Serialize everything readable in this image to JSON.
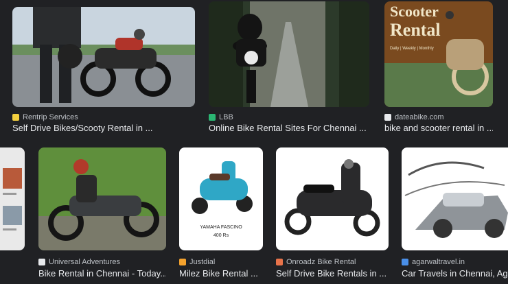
{
  "results": [
    {
      "source": "Rentrip Services",
      "title": "Self Drive Bikes/Scooty Rental in ...",
      "favicon_color": "#f4d03f"
    },
    {
      "source": "LBB",
      "title": "Online Bike Rental Sites For Chennai ...",
      "favicon_color": "#2bb673"
    },
    {
      "source": "dateabike.com",
      "title": "bike and scooter rental in ...",
      "favicon_color": "#e8eaed",
      "poster_text": "Scooter",
      "poster_title": "Rental",
      "poster_sub": "Daily | Weekly | Monthly"
    },
    {
      "source": "Universal Adventures",
      "title": "Bike Rental in Chennai - Today...",
      "favicon_color": "#e8eaed"
    },
    {
      "source": "Justdial",
      "title": "Milez Bike Rental ...",
      "favicon_color": "#f4a22d",
      "caption_name": "YAMAHA FASCINO",
      "caption_price": "400 Rs"
    },
    {
      "source": "Onroadz Bike Rental",
      "title": "Self Drive Bike Rentals in ...",
      "favicon_color": "#e8734a"
    },
    {
      "source": "agarwaltravel.in",
      "title": "Car Travels in Chennai, Aga",
      "favicon_color": "#4a8fe8"
    }
  ]
}
